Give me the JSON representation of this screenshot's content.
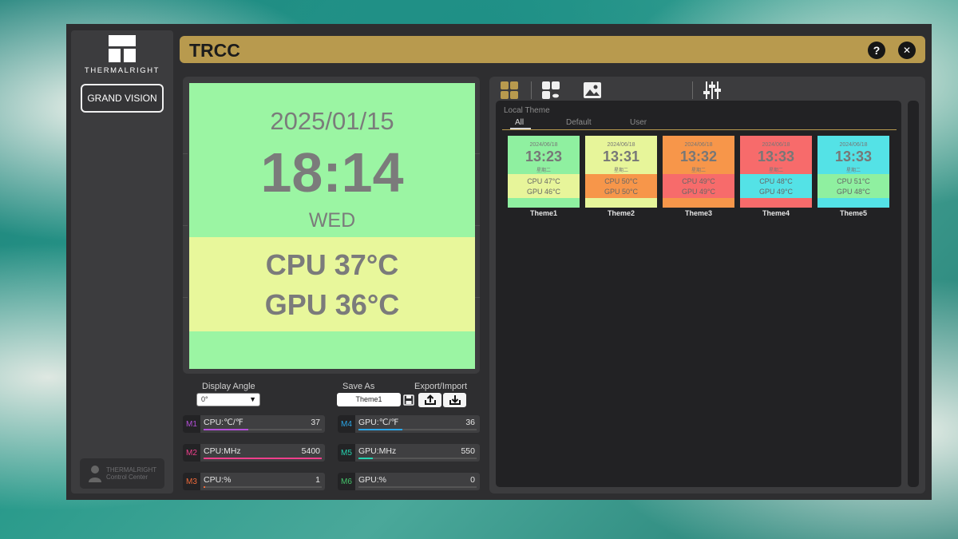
{
  "app": {
    "title": "TRCC",
    "brand": "THERMALRIGHT",
    "device_button": "GRAND VISION",
    "control_center": [
      "THERMALRIGHT",
      "Control Center"
    ],
    "help_icon_glyph": "?",
    "close_icon_glyph": "✕"
  },
  "preview": {
    "date": "2025/01/15",
    "time": "18:14",
    "day": "WED",
    "cpu_temp": "CPU  37°C",
    "gpu_temp": "GPU  36°C",
    "colors": {
      "top": "#9bf5a3",
      "middle": "#e8f79b"
    }
  },
  "controls": {
    "display_angle_label": "Display Angle",
    "display_angle_value": "0°",
    "save_as_label": "Save As",
    "save_as_value": "Theme1",
    "export_import_label": "Export/Import"
  },
  "metrics": [
    {
      "tag": "M1",
      "name": "CPU:℃/℉",
      "value": "37",
      "level": 0.38,
      "color": "#b34fd8"
    },
    {
      "tag": "M2",
      "name": "CPU:MHz",
      "value": "5400",
      "level": 1.0,
      "color": "#ef3f8c"
    },
    {
      "tag": "M3",
      "name": "CPU:%",
      "value": "1",
      "level": 0.01,
      "color": "#ef6a3a"
    },
    {
      "tag": "M4",
      "name": "GPU:℃/℉",
      "value": "36",
      "level": 0.37,
      "color": "#2aa6e8"
    },
    {
      "tag": "M5",
      "name": "GPU:MHz",
      "value": "550",
      "level": 0.12,
      "color": "#25d3b0"
    },
    {
      "tag": "M6",
      "name": "GPU:%",
      "value": "0",
      "level": 0.0,
      "color": "#44c46a"
    }
  ],
  "themes_panel": {
    "header": "Local Theme",
    "filters": [
      "All",
      "Default",
      "User"
    ],
    "active_filter": "All",
    "tab_icons": [
      "local-themes-icon",
      "cloud-themes-icon",
      "image-icon",
      "sliders-icon"
    ],
    "accent": "#b89a4e"
  },
  "themes": [
    {
      "name": "Theme1",
      "date": "2024/06/18",
      "time": "13:23",
      "day": "星期二",
      "cpu": "CPU  47°C",
      "gpu": "GPU  46°C",
      "colors": {
        "top": "#8ff0a0",
        "mid": "#e7f59a",
        "bot": "#8ff0a0"
      }
    },
    {
      "name": "Theme2",
      "date": "2024/06/18",
      "time": "13:31",
      "day": "星期二",
      "cpu": "CPU  50°C",
      "gpu": "GPU  50°C",
      "colors": {
        "top": "#e7f59a",
        "mid": "#f7964a",
        "bot": "#e7f59a"
      }
    },
    {
      "name": "Theme3",
      "date": "2024/06/18",
      "time": "13:32",
      "day": "星期二",
      "cpu": "CPU  49°C",
      "gpu": "GPU  49°C",
      "colors": {
        "top": "#f7964a",
        "mid": "#f76b6b",
        "bot": "#f7964a"
      }
    },
    {
      "name": "Theme4",
      "date": "2024/06/18",
      "time": "13:33",
      "day": "星期二",
      "cpu": "CPU  48°C",
      "gpu": "GPU  49°C",
      "colors": {
        "top": "#f76b6b",
        "mid": "#54e2e6",
        "bot": "#f76b6b"
      }
    },
    {
      "name": "Theme5",
      "date": "2024/06/18",
      "time": "13:33",
      "day": "星期二",
      "cpu": "CPU  51°C",
      "gpu": "GPU  48°C",
      "colors": {
        "top": "#54e2e6",
        "mid": "#8ff0a0",
        "bot": "#54e2e6"
      }
    }
  ]
}
